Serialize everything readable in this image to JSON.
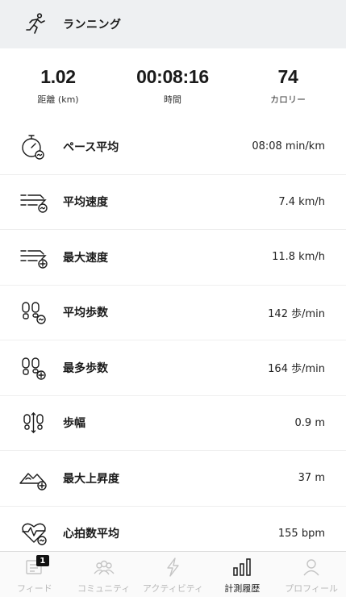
{
  "header": {
    "title": "ランニング",
    "icon": "running-person-icon"
  },
  "summary": {
    "distance": {
      "value": "1.02",
      "label": "距離 (km)"
    },
    "time": {
      "value": "00:08:16",
      "label": "時間"
    },
    "calories": {
      "value": "74",
      "label": "カロリー"
    }
  },
  "metrics": [
    {
      "label": "ペース平均",
      "value": "08:08 min/km",
      "icon": "pace-stopwatch-icon"
    },
    {
      "label": "平均速度",
      "value": "7.4 km/h",
      "icon": "speed-average-icon"
    },
    {
      "label": "最大速度",
      "value": "11.8 km/h",
      "icon": "speed-max-icon"
    },
    {
      "label": "平均歩数",
      "value": "142 歩/min",
      "icon": "steps-average-icon"
    },
    {
      "label": "最多歩数",
      "value": "164 歩/min",
      "icon": "steps-max-icon"
    },
    {
      "label": "歩幅",
      "value": "0.9 m",
      "icon": "stride-icon"
    },
    {
      "label": "最大上昇度",
      "value": "37 m",
      "icon": "elevation-icon"
    },
    {
      "label": "心拍数平均",
      "value": "155 bpm",
      "icon": "heart-rate-icon"
    }
  ],
  "tabbar": {
    "tabs": [
      {
        "label": "フィード",
        "icon": "feed-icon",
        "badge": "1",
        "active": false
      },
      {
        "label": "コミュニティ",
        "icon": "community-icon",
        "active": false
      },
      {
        "label": "アクティビティ",
        "icon": "activity-bolt-icon",
        "active": false
      },
      {
        "label": "計測履歴",
        "icon": "history-bars-icon",
        "active": true
      },
      {
        "label": "プロフィール",
        "icon": "profile-icon",
        "active": false
      }
    ]
  },
  "colors": {
    "header_bg": "#eef0f2",
    "text": "#1a1a1a",
    "tab_inactive": "#b9b9b9",
    "tab_active": "#1a1a1a"
  }
}
